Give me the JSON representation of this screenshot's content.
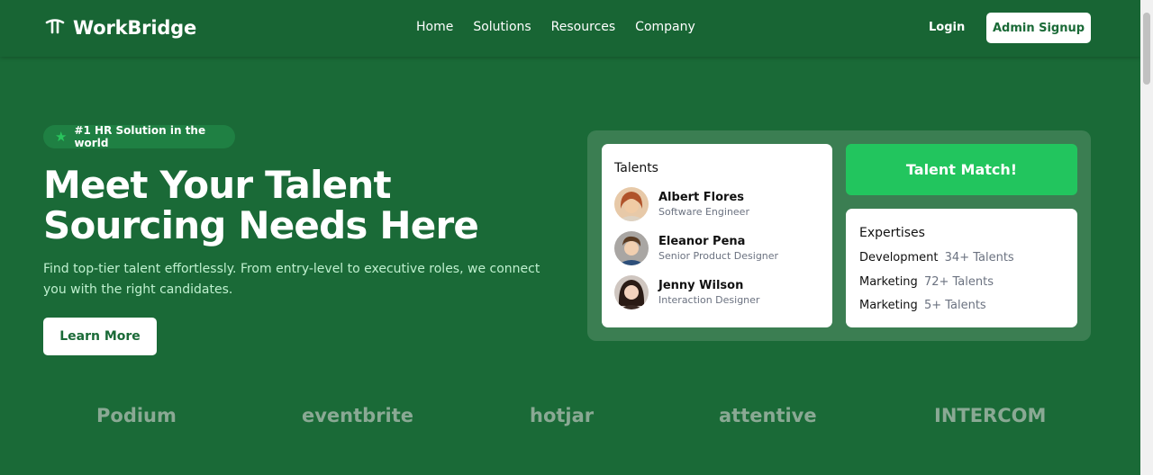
{
  "nav": {
    "brand": "WorkBridge",
    "links": [
      "Home",
      "Solutions",
      "Resources",
      "Company"
    ],
    "login": "Login",
    "signup": "Admin Signup"
  },
  "hero": {
    "badge": "#1 HR Solution in the world",
    "title_line1": "Meet Your Talent",
    "title_line2": "Sourcing Needs Here",
    "subtitle": "Find top-tier talent effortlessly. From entry-level to executive roles, we connect you with the right candidates.",
    "cta": "Learn More"
  },
  "talents": {
    "title": "Talents",
    "people": [
      {
        "name": "Albert Flores",
        "role": "Software Engineer"
      },
      {
        "name": "Eleanor Pena",
        "role": "Senior Product Designer"
      },
      {
        "name": "Jenny Wilson",
        "role": "Interaction Designer"
      }
    ]
  },
  "match": {
    "label": "Talent Match!"
  },
  "expertises": {
    "title": "Expertises",
    "items": [
      {
        "field": "Development",
        "count": "34+ Talents"
      },
      {
        "field": "Marketing",
        "count": "72+ Talents"
      },
      {
        "field": "Marketing",
        "count": "5+ Talents"
      }
    ]
  },
  "partners": [
    "Podium",
    "eventbrite",
    "hotjar",
    "attentive",
    "INTERCOM"
  ],
  "colors": {
    "background": "#1a6a37",
    "navbar": "#186534",
    "accent": "#22c55e",
    "badge_bg": "#1f8043",
    "panel": "#3b7e52",
    "partner_logo": "#8aa994"
  }
}
